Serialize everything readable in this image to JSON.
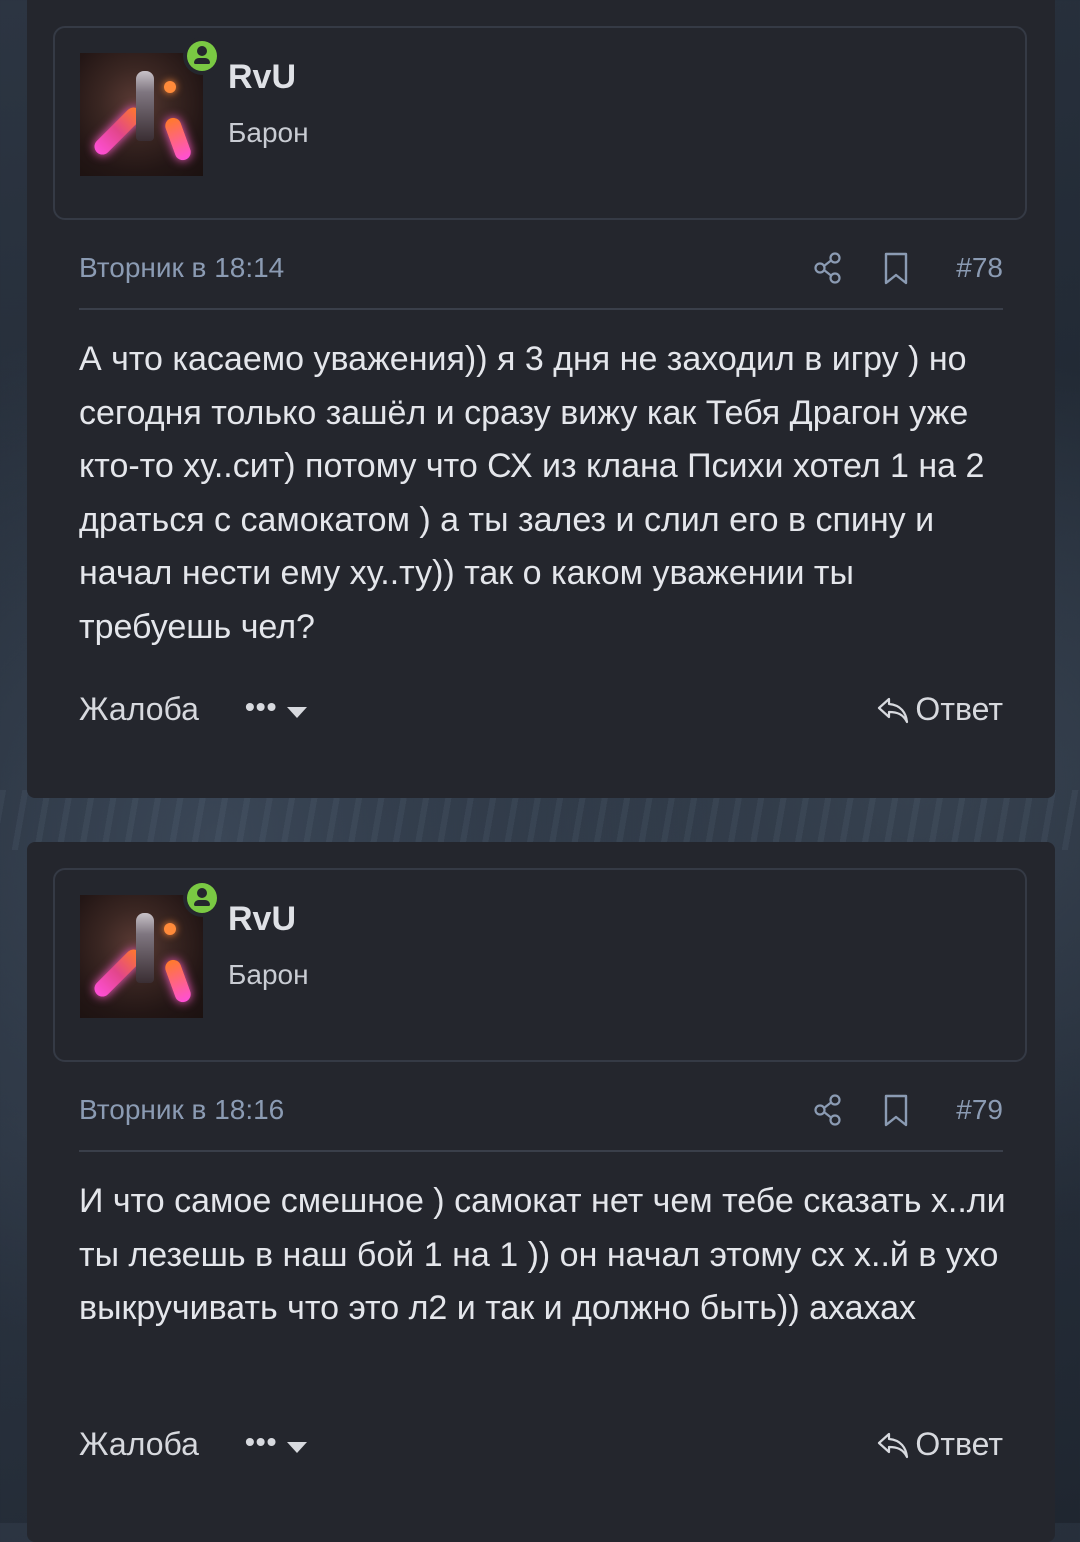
{
  "posts": [
    {
      "username": "RvU",
      "user_title": "Барон",
      "date": "Вторник в 18:14",
      "post_number": "#78",
      "content": "А что касаемо уважения)) я 3 дня не заходил в игру ) но сегодня только зашёл и сразу вижу как Тебя Драгон уже кто-то ху..сит) потому что СХ из клана Психи хотел 1 на 2 драться с самокатом ) а ты залез и слил его в спину и начал нести ему ху..ту)) так о каком уважении ты требуешь чел?",
      "report_label": "Жалоба",
      "more_label": "•••",
      "reply_label": "Ответ"
    },
    {
      "username": "RvU",
      "user_title": "Барон",
      "date": "Вторник в 18:16",
      "post_number": "#79",
      "content": "И что самое смешное ) самокат нет чем тебе сказать х..ли ты лезешь в наш бой 1 на 1 )) он начал этому сх х..й в ухо выкручивать что это л2 и так и должно быть)) ахахах",
      "report_label": "Жалоба",
      "more_label": "•••",
      "reply_label": "Ответ"
    }
  ],
  "icons": {
    "online": "online-user-icon",
    "share": "share-icon",
    "bookmark": "bookmark-icon",
    "caret": "chevron-down-icon",
    "reply": "reply-arrow-icon"
  },
  "colors": {
    "online_green": "#7ac943",
    "meta_blue": "#8b9bb3",
    "post_bg": "#24262d",
    "text": "#e4e6eb"
  }
}
